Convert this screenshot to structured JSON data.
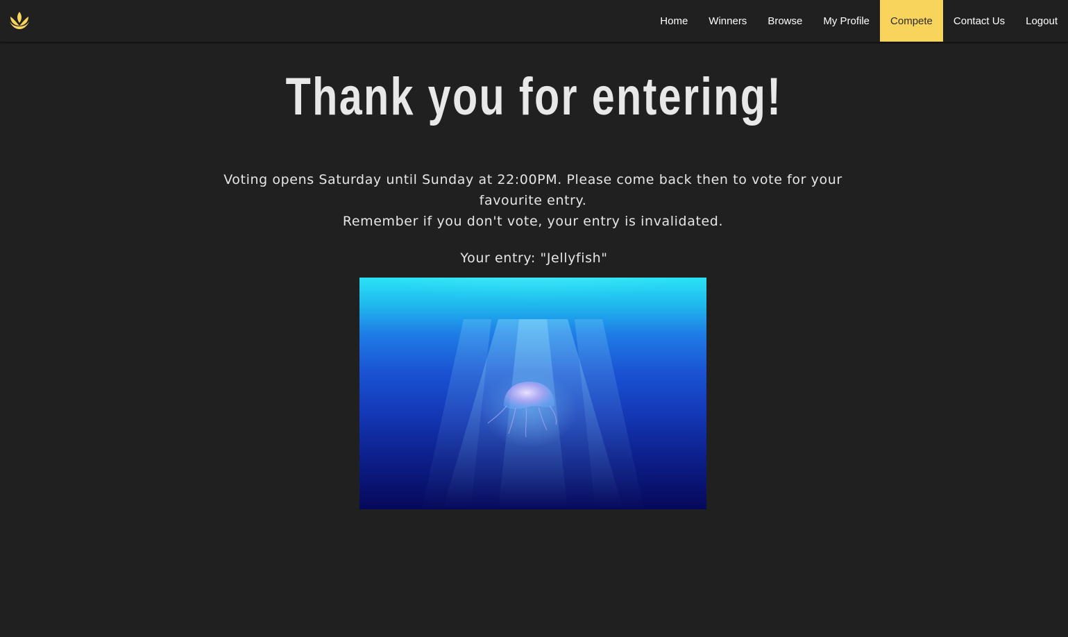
{
  "nav": {
    "logo_icon": "lotus-logo-icon",
    "items": [
      {
        "label": "Home",
        "active": false
      },
      {
        "label": "Winners",
        "active": false
      },
      {
        "label": "Browse",
        "active": false
      },
      {
        "label": "My Profile",
        "active": false
      },
      {
        "label": "Compete",
        "active": true
      },
      {
        "label": "Contact Us",
        "active": false
      },
      {
        "label": "Logout",
        "active": false
      }
    ]
  },
  "main": {
    "title": "Thank you for entering!",
    "info_line1": "Voting opens Saturday until Sunday at 22:00PM. Please come back then to vote for your favourite entry.",
    "info_line2": "Remember if you don't vote, your entry is invalidated.",
    "entry_label": "Your entry: \"Jellyfish\"",
    "entry_image_alt": "Jellyfish"
  },
  "colors": {
    "background": "#202020",
    "accent": "#f8d45c",
    "text": "#e6e6e6"
  }
}
